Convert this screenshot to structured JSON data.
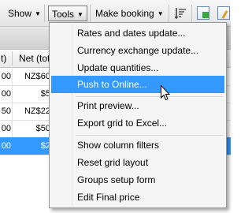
{
  "toolbar": {
    "show_label": "Show",
    "tools_label": "Tools",
    "make_booking_label": "Make booking",
    "sort_icon": "sort-lines-icon",
    "export_icon": "export-icon",
    "edit_icon": "edit-icon"
  },
  "grid": {
    "columns": [
      "t)",
      "Net (tot"
    ],
    "rows": [
      {
        "c1": "00",
        "c2": "NZ$60"
      },
      {
        "c1": "00",
        "c2": "$5"
      },
      {
        "c1": "50",
        "c2": "NZ$22"
      },
      {
        "c1": "00",
        "c2": "$50"
      },
      {
        "c1": "00",
        "c2": "$2",
        "selected": true
      }
    ]
  },
  "menu": {
    "items": [
      {
        "label": "Rates and dates update..."
      },
      {
        "label": "Currency exchange update..."
      },
      {
        "label": "Update quantities..."
      },
      {
        "label": "Push to Online...",
        "hover": true
      },
      {
        "label": "Print preview..."
      },
      {
        "label": "Export grid to Excel..."
      },
      {
        "label": "Show column filters"
      },
      {
        "label": "Reset grid layout"
      },
      {
        "label": "Groups setup form"
      },
      {
        "label": "Edit Final price"
      }
    ]
  },
  "colors": {
    "highlight": "#3399ff",
    "menu_bg": "#f5f5f5"
  }
}
